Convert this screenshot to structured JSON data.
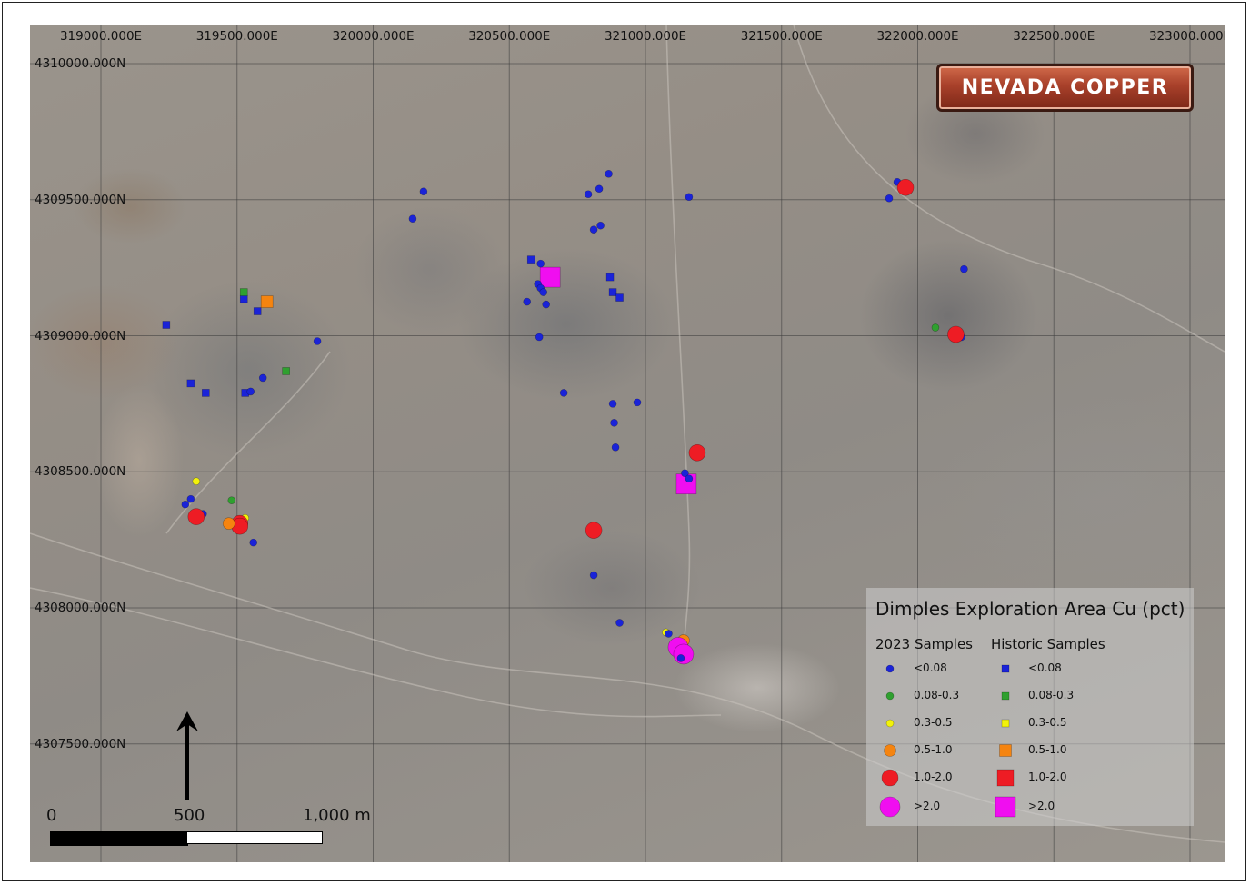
{
  "map": {
    "x_ticks": [
      "319000.000E",
      "319500.000E",
      "320000.000E",
      "320500.000E",
      "321000.000E",
      "321500.000E",
      "322000.000E",
      "322500.000E",
      "323000.000E"
    ],
    "y_ticks": [
      "4310000.000N",
      "4309500.000N",
      "4309000.000N",
      "4308500.000N",
      "4308000.000N",
      "4307500.000N"
    ],
    "logo_text": "NEVADA COPPER",
    "scale_bar": {
      "labels": [
        "0",
        "500",
        "1,000 m"
      ]
    },
    "north_arrow": "north-arrow-icon",
    "colors": {
      "lt008": "#1a23d8",
      "c008_03": "#2fa02f",
      "c03_05": "#f2f20a",
      "c05_10": "#f58410",
      "c10_20": "#ee1c24",
      "gt20": "#f00ef0"
    },
    "samples_2023": [
      {
        "x": 319330,
        "y": 4308400,
        "cls": "lt008"
      },
      {
        "x": 319310,
        "y": 4308380,
        "cls": "lt008"
      },
      {
        "x": 319375,
        "y": 4308345,
        "cls": "lt008"
      },
      {
        "x": 319350,
        "y": 4308335,
        "cls": "c10_20"
      },
      {
        "x": 319350,
        "y": 4308465,
        "cls": "c03_05"
      },
      {
        "x": 319480,
        "y": 4308395,
        "cls": "c008_03"
      },
      {
        "x": 319530,
        "y": 4308330,
        "cls": "c03_05"
      },
      {
        "x": 319510,
        "y": 4308310,
        "cls": "c10_20"
      },
      {
        "x": 319510,
        "y": 4308300,
        "cls": "c10_20"
      },
      {
        "x": 319470,
        "y": 4308310,
        "cls": "c05_10"
      },
      {
        "x": 319560,
        "y": 4308240,
        "cls": "lt008"
      },
      {
        "x": 319550,
        "y": 4308795,
        "cls": "lt008"
      },
      {
        "x": 319595,
        "y": 4308845,
        "cls": "lt008"
      },
      {
        "x": 319795,
        "y": 4308980,
        "cls": "lt008"
      },
      {
        "x": 320145,
        "y": 4309430,
        "cls": "lt008"
      },
      {
        "x": 320185,
        "y": 4309530,
        "cls": "lt008"
      },
      {
        "x": 320615,
        "y": 4309265,
        "cls": "lt008"
      },
      {
        "x": 320605,
        "y": 4309190,
        "cls": "lt008"
      },
      {
        "x": 320615,
        "y": 4309175,
        "cls": "lt008"
      },
      {
        "x": 320625,
        "y": 4309160,
        "cls": "lt008"
      },
      {
        "x": 320565,
        "y": 4309125,
        "cls": "lt008"
      },
      {
        "x": 320635,
        "y": 4309115,
        "cls": "lt008"
      },
      {
        "x": 320610,
        "y": 4308995,
        "cls": "lt008"
      },
      {
        "x": 320790,
        "y": 4309520,
        "cls": "lt008"
      },
      {
        "x": 320830,
        "y": 4309540,
        "cls": "lt008"
      },
      {
        "x": 320865,
        "y": 4309595,
        "cls": "lt008"
      },
      {
        "x": 320810,
        "y": 4309390,
        "cls": "lt008"
      },
      {
        "x": 320835,
        "y": 4309405,
        "cls": "lt008"
      },
      {
        "x": 320700,
        "y": 4308790,
        "cls": "lt008"
      },
      {
        "x": 320880,
        "y": 4308750,
        "cls": "lt008"
      },
      {
        "x": 320970,
        "y": 4308755,
        "cls": "lt008"
      },
      {
        "x": 320885,
        "y": 4308680,
        "cls": "lt008"
      },
      {
        "x": 320890,
        "y": 4308590,
        "cls": "lt008"
      },
      {
        "x": 321160,
        "y": 4309510,
        "cls": "lt008"
      },
      {
        "x": 321190,
        "y": 4308570,
        "cls": "c10_20"
      },
      {
        "x": 321145,
        "y": 4308495,
        "cls": "lt008"
      },
      {
        "x": 321160,
        "y": 4308475,
        "cls": "lt008"
      },
      {
        "x": 320810,
        "y": 4308285,
        "cls": "c10_20"
      },
      {
        "x": 320810,
        "y": 4308120,
        "cls": "lt008"
      },
      {
        "x": 320905,
        "y": 4307945,
        "cls": "lt008"
      },
      {
        "x": 321075,
        "y": 4307910,
        "cls": "c03_05"
      },
      {
        "x": 321085,
        "y": 4307905,
        "cls": "lt008"
      },
      {
        "x": 321140,
        "y": 4307880,
        "cls": "c05_10"
      },
      {
        "x": 321120,
        "y": 4307855,
        "cls": "gt20"
      },
      {
        "x": 321140,
        "y": 4307830,
        "cls": "gt20"
      },
      {
        "x": 321130,
        "y": 4307815,
        "cls": "lt008"
      },
      {
        "x": 321925,
        "y": 4309565,
        "cls": "lt008"
      },
      {
        "x": 321895,
        "y": 4309505,
        "cls": "lt008"
      },
      {
        "x": 321955,
        "y": 4309545,
        "cls": "c10_20"
      },
      {
        "x": 322170,
        "y": 4309245,
        "cls": "lt008"
      },
      {
        "x": 322065,
        "y": 4309030,
        "cls": "c008_03"
      },
      {
        "x": 322160,
        "y": 4308995,
        "cls": "lt008"
      },
      {
        "x": 322140,
        "y": 4309005,
        "cls": "c10_20"
      }
    ],
    "samples_historic": [
      {
        "x": 319240,
        "y": 4309040,
        "cls": "lt008"
      },
      {
        "x": 319525,
        "y": 4309135,
        "cls": "lt008"
      },
      {
        "x": 319575,
        "y": 4309090,
        "cls": "lt008"
      },
      {
        "x": 319525,
        "y": 4309160,
        "cls": "c008_03"
      },
      {
        "x": 319610,
        "y": 4309125,
        "cls": "c05_10"
      },
      {
        "x": 319330,
        "y": 4308825,
        "cls": "lt008"
      },
      {
        "x": 319385,
        "y": 4308790,
        "cls": "lt008"
      },
      {
        "x": 319530,
        "y": 4308790,
        "cls": "lt008"
      },
      {
        "x": 319680,
        "y": 4308870,
        "cls": "c008_03"
      },
      {
        "x": 320580,
        "y": 4309280,
        "cls": "lt008"
      },
      {
        "x": 320650,
        "y": 4309215,
        "cls": "gt20"
      },
      {
        "x": 320870,
        "y": 4309215,
        "cls": "lt008"
      },
      {
        "x": 320880,
        "y": 4309160,
        "cls": "lt008"
      },
      {
        "x": 320905,
        "y": 4309140,
        "cls": "lt008"
      },
      {
        "x": 321150,
        "y": 4308455,
        "cls": "gt20"
      }
    ],
    "legend": {
      "title": "Dimples Exploration Area Cu (pct)",
      "col_2023": "2023 Samples",
      "col_historic": "Historic Samples",
      "classes": [
        {
          "key": "lt008",
          "label": "<0.08"
        },
        {
          "key": "c008_03",
          "label": "0.08-0.3"
        },
        {
          "key": "c03_05",
          "label": "0.3-0.5"
        },
        {
          "key": "c05_10",
          "label": "0.5-1.0"
        },
        {
          "key": "c10_20",
          "label": "1.0-2.0"
        },
        {
          "key": "gt20",
          "label": ">2.0"
        }
      ]
    }
  }
}
